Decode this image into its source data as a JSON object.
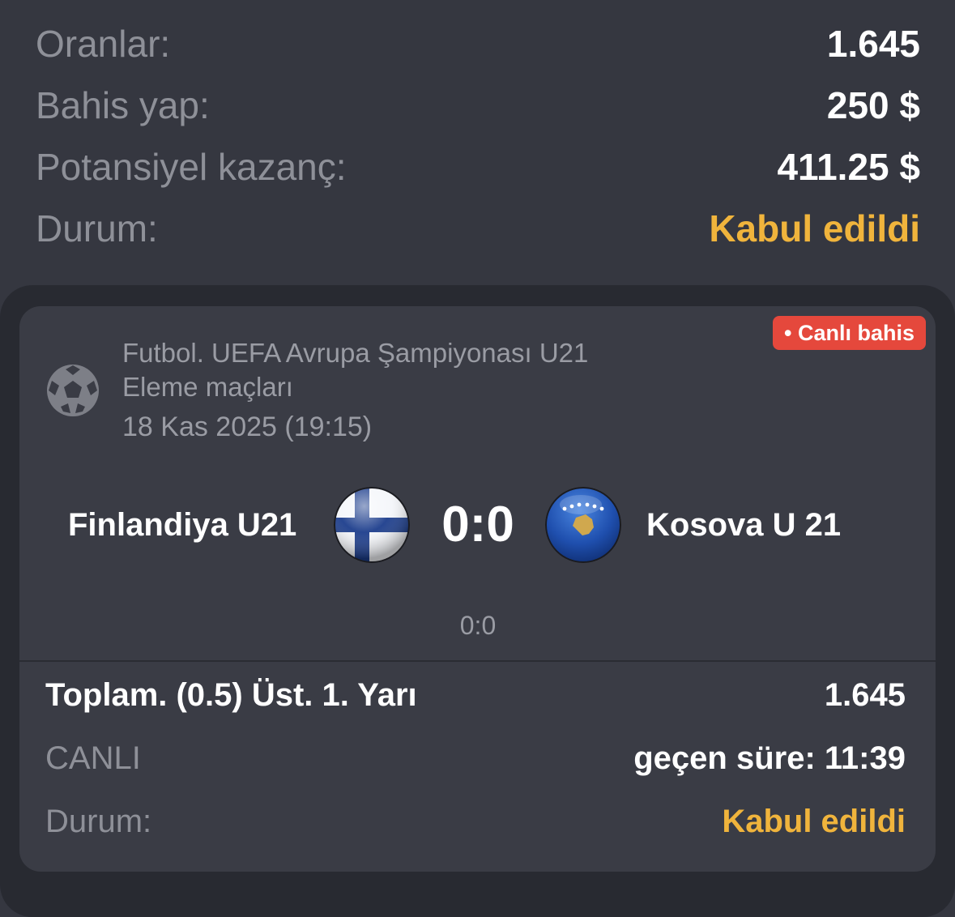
{
  "summary": {
    "odds_label": "Oranlar:",
    "odds_value": "1.645",
    "stake_label": "Bahis yap:",
    "stake_value": "250 $",
    "potential_label": "Potansiyel kazanç:",
    "potential_value": "411.25 $",
    "status_label": "Durum:",
    "status_value": "Kabul edildi"
  },
  "event": {
    "badge": "• Canlı bahis",
    "sport_icon": "soccer-ball-icon",
    "league_line1": "Futbol. UEFA Avrupa Şampiyonası U21",
    "league_line2": "Eleme maçları",
    "date": "18 Kas 2025 (19:15)",
    "home_team": "Finlandiya U21",
    "away_team": "Kosova U 21",
    "home_flag": "finland-flag-icon",
    "away_flag": "kosovo-flag-icon",
    "score": "0:0",
    "half_score": "0:0"
  },
  "bet": {
    "market": "Toplam. (0.5) Üst. 1. Yarı",
    "odds": "1.645",
    "live_label": "CANLI",
    "elapsed": "geçen süre: 11:39",
    "status_label": "Durum:",
    "status_value": "Kabul edildi"
  },
  "colors": {
    "background": "#353740",
    "card": "#3a3c45",
    "accent": "#f0b43c",
    "badge": "#e5483c"
  }
}
